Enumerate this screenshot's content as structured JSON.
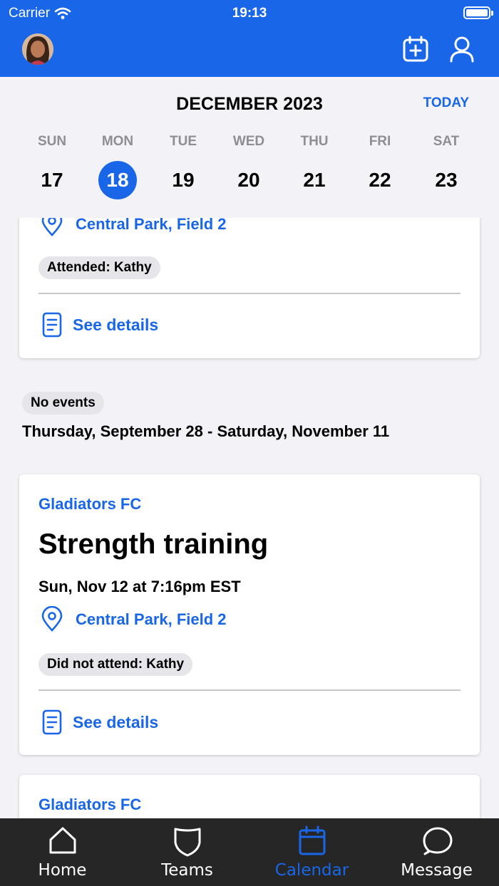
{
  "status_bar": {
    "carrier": "Carrier",
    "time": "19:13"
  },
  "header": {
    "avatar": "user-avatar",
    "icons": [
      "calendar-add-icon",
      "profile-icon"
    ]
  },
  "calendar": {
    "month_title": "DECEMBER 2023",
    "today_label": "TODAY",
    "days": [
      {
        "dow": "SUN",
        "num": "17"
      },
      {
        "dow": "MON",
        "num": "18"
      },
      {
        "dow": "TUE",
        "num": "19"
      },
      {
        "dow": "WED",
        "num": "20"
      },
      {
        "dow": "THU",
        "num": "21"
      },
      {
        "dow": "FRI",
        "num": "22"
      },
      {
        "dow": "SAT",
        "num": "23"
      }
    ],
    "selected_day": "18"
  },
  "events": {
    "partial": {
      "location": "Central Park, Field 2",
      "attendance": "Attended: Kathy",
      "details_label": "See details"
    },
    "gap": {
      "badge": "No events",
      "range": "Thursday, September 28 - Saturday, November 11"
    },
    "strength": {
      "team": "Gladiators FC",
      "title": "Strength training",
      "datetime": "Sun, Nov 12 at 7:16pm EST",
      "location": "Central Park, Field 2",
      "attendance": "Did not attend: Kathy",
      "details_label": "See details"
    },
    "next": {
      "team": "Gladiators FC"
    }
  },
  "tabbar": {
    "tabs": [
      {
        "label": "Home",
        "icon": "home-icon"
      },
      {
        "label": "Teams",
        "icon": "shield-icon"
      },
      {
        "label": "Calendar",
        "icon": "calendar-icon"
      },
      {
        "label": "Message",
        "icon": "message-icon"
      }
    ],
    "active": "Calendar"
  },
  "colors": {
    "brand_blue": "#1a66e8",
    "tabbar_bg": "#262626",
    "page_bg": "#f2f2f7"
  }
}
